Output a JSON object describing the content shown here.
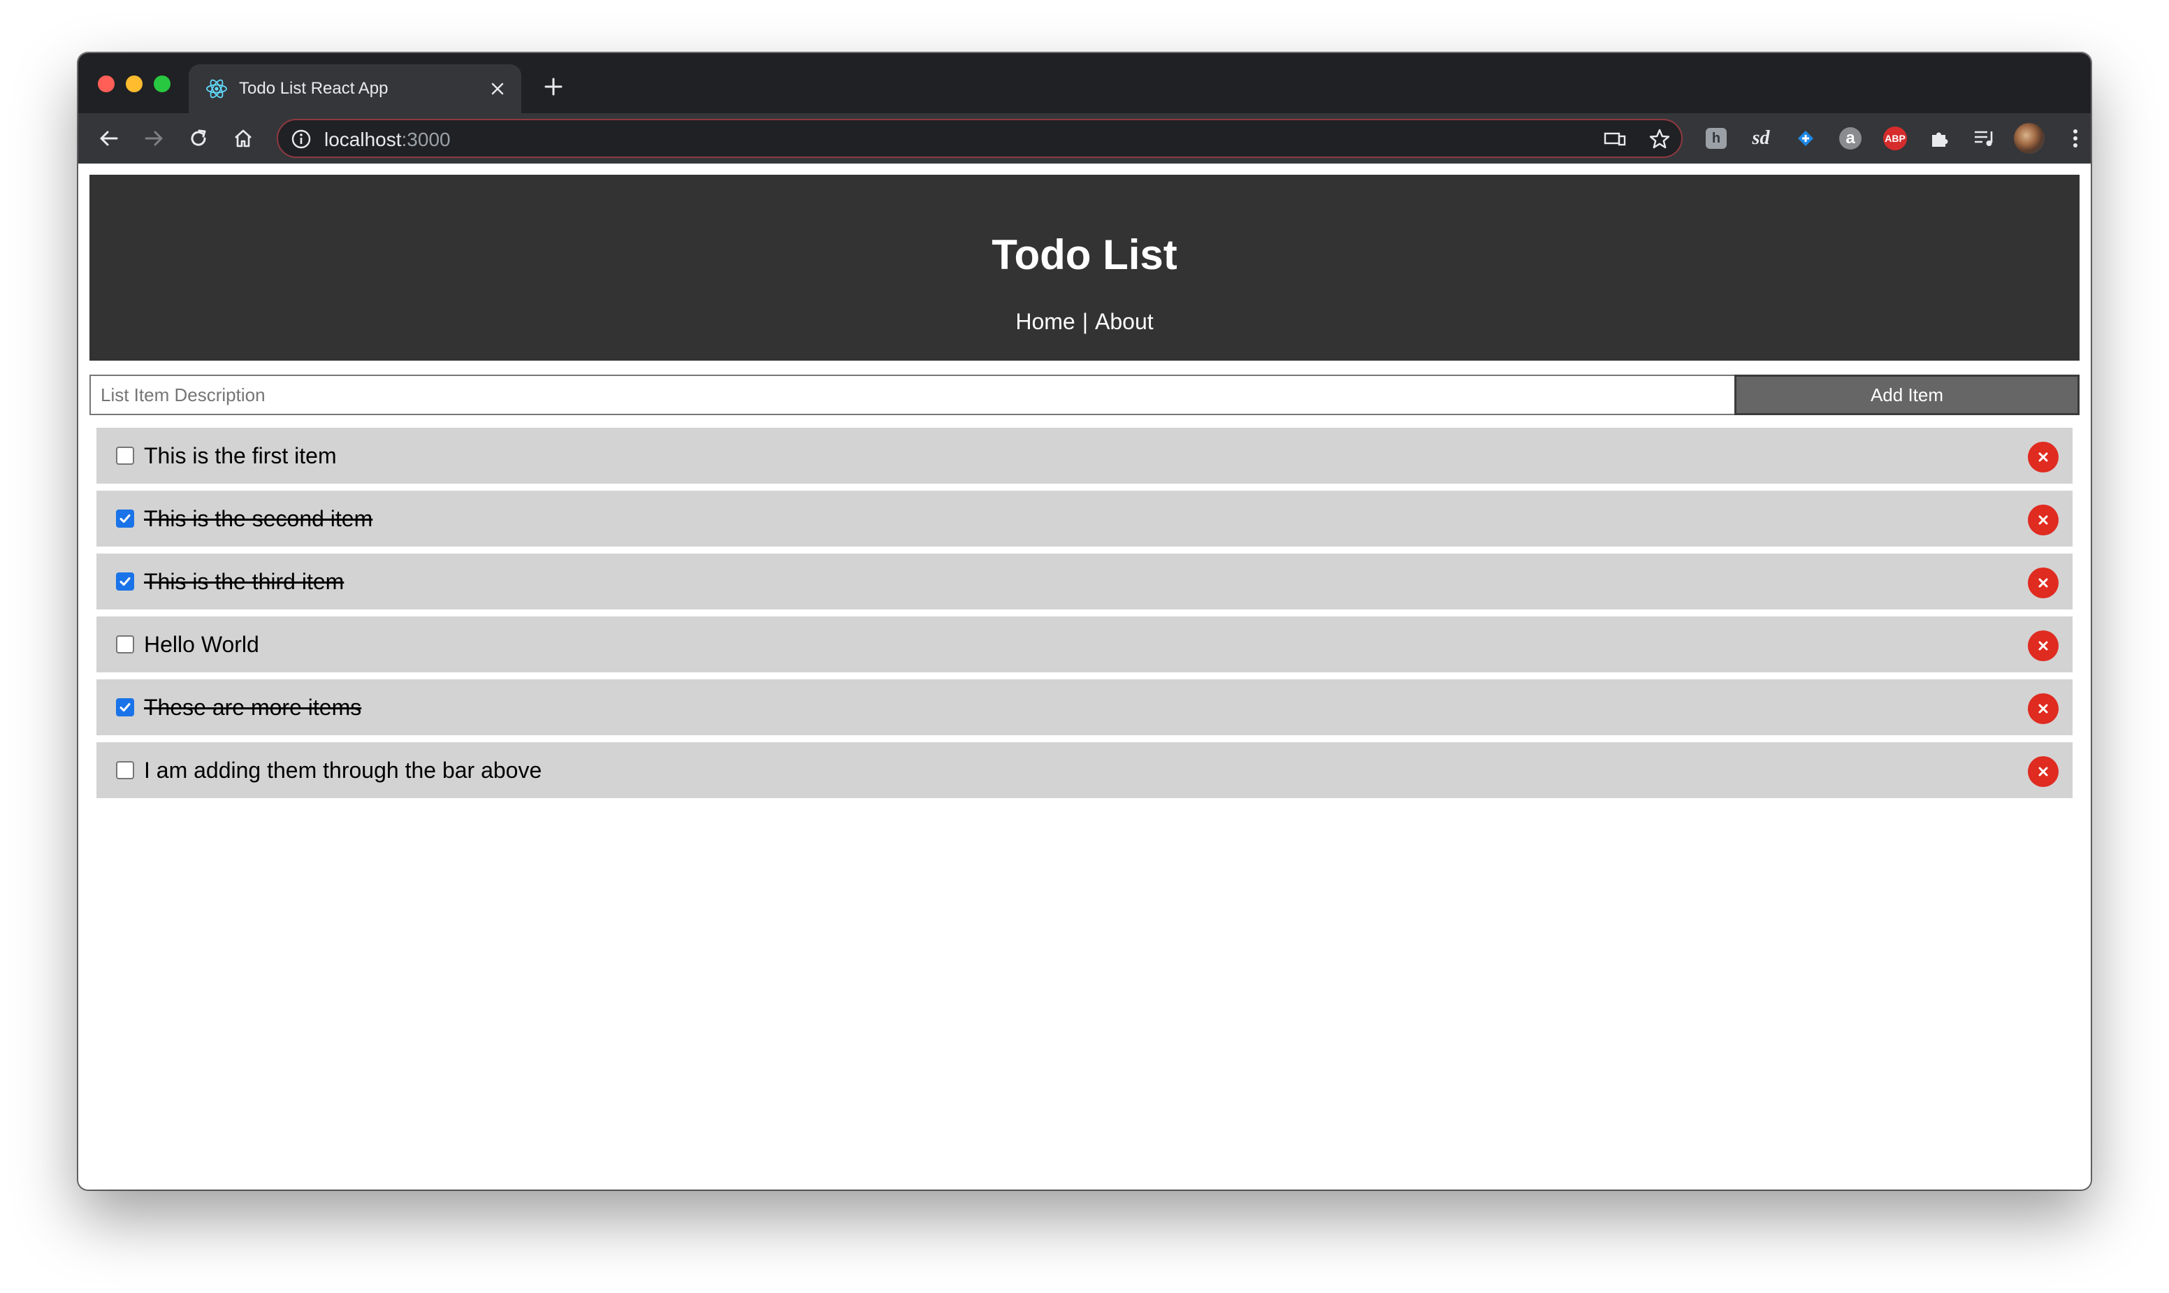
{
  "browser": {
    "tab_title": "Todo List React App",
    "url_host": "localhost",
    "url_port": ":3000",
    "extensions": {
      "honey": "h",
      "sd": "sd",
      "amazon": "a",
      "abp": "ABP"
    }
  },
  "app": {
    "title": "Todo List",
    "nav": {
      "home": "Home",
      "separator": "|",
      "about": "About"
    },
    "form": {
      "placeholder": "List Item Description",
      "button_label": "Add Item"
    },
    "items": [
      {
        "text": "This is the first item",
        "completed": false
      },
      {
        "text": "This is the second item",
        "completed": true
      },
      {
        "text": "This is the third item",
        "completed": true
      },
      {
        "text": "Hello World",
        "completed": false
      },
      {
        "text": "These are more items",
        "completed": true
      },
      {
        "text": "I am adding them through the bar above",
        "completed": false
      }
    ]
  },
  "colors": {
    "header_bg": "#333333",
    "item_bg": "#d3d3d3",
    "delete_red": "#e02b20",
    "button_bg": "#666666"
  }
}
